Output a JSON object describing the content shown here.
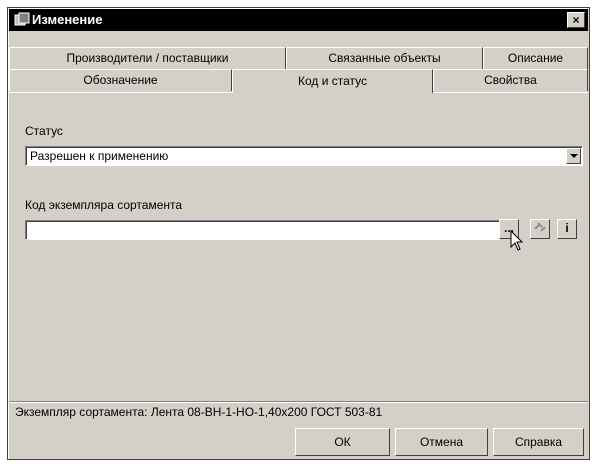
{
  "window": {
    "title": "Изменение",
    "close_label": "×"
  },
  "tabs": {
    "row1": [
      {
        "label": "Производители / поставщики"
      },
      {
        "label": "Связанные объекты"
      },
      {
        "label": "Описание"
      }
    ],
    "row2": [
      {
        "label": "Обозначение"
      },
      {
        "label": "Код и статус",
        "active": true
      },
      {
        "label": "Свойства"
      }
    ]
  },
  "form": {
    "status_label": "Статус",
    "status_value": "Разрешен к применению",
    "code_label": "Код экземпляра сортамента",
    "code_value": "",
    "browse_button": "...",
    "info_button": "i"
  },
  "status_bar": {
    "text": "Экземпляр сортамента: Лента 08-ВН-1-НО-1,40х200 ГОСТ 503-81"
  },
  "buttons": {
    "ok": "ОК",
    "cancel": "Отмена",
    "help": "Справка"
  },
  "colors": {
    "face": "#d4d0c8",
    "titlebar": "#000000"
  }
}
